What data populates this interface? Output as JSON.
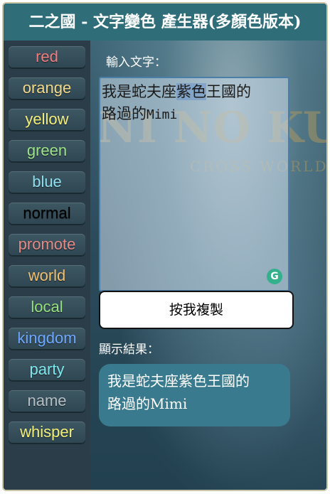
{
  "title": "二之國 - 文字變色 產生器(多顏色版本)",
  "background_logo": "NI NO KUNI",
  "background_subtitle": "CROSS WORLDS",
  "colors": {
    "title_bar": "#2f6e78",
    "sidebar": "#2a3d48",
    "result_bubble": "#3a7a8e"
  },
  "sidebar": {
    "buttons": [
      {
        "label": "red",
        "color": "#f07e7e"
      },
      {
        "label": "orange",
        "color": "#f3d98a"
      },
      {
        "label": "yellow",
        "color": "#f6f07a"
      },
      {
        "label": "green",
        "color": "#9ee38a"
      },
      {
        "label": "blue",
        "color": "#8fe0ee"
      },
      {
        "label": "normal",
        "color": "#000000"
      },
      {
        "label": "promote",
        "color": "#e58a86"
      },
      {
        "label": "world",
        "color": "#f0c070"
      },
      {
        "label": "local",
        "color": "#97e07e"
      },
      {
        "label": "kingdom",
        "color": "#6fa8ff"
      },
      {
        "label": "party",
        "color": "#7fe8ee"
      },
      {
        "label": "name",
        "color": "#b5c0c5"
      },
      {
        "label": "whisper",
        "color": "#f3f17a"
      }
    ]
  },
  "input": {
    "label": "輸入文字：",
    "value_before_highlight": "我是蛇夫座",
    "value_highlight": "紫色",
    "value_after_highlight": "王國的",
    "value_line2_cjk": "路過的",
    "value_line2_latin": "Mimi"
  },
  "copy_button_label": "按我複製",
  "grammarly_icon_letter": "G",
  "result": {
    "label": "顯示結果：",
    "line1": "我是蛇夫座紫色王國的",
    "line2": "路過的Mimi"
  }
}
